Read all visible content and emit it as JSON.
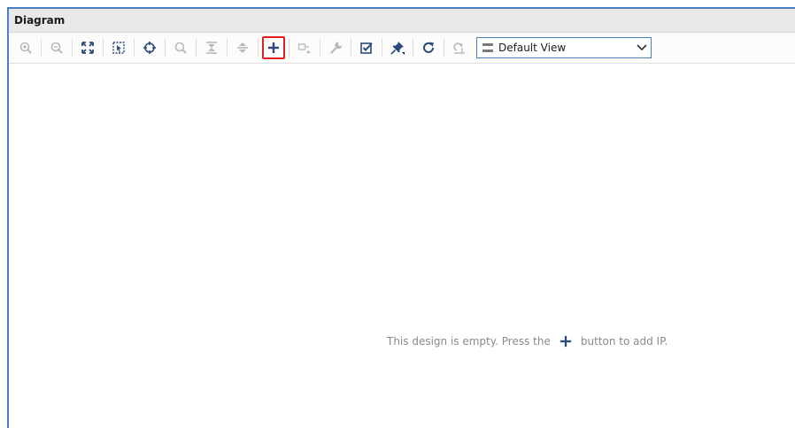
{
  "panel": {
    "title": "Diagram"
  },
  "toolbar": {
    "buttons": [
      {
        "icon": "zoom-in-icon",
        "enabled": false
      },
      {
        "icon": "zoom-out-icon",
        "enabled": false
      },
      {
        "icon": "zoom-fit-icon",
        "enabled": true
      },
      {
        "icon": "zoom-selection-icon",
        "enabled": true
      },
      {
        "icon": "crosshair-icon",
        "enabled": true
      },
      {
        "icon": "search-icon",
        "enabled": false
      },
      {
        "icon": "collapse-all-icon",
        "enabled": false
      },
      {
        "icon": "expand-all-icon",
        "enabled": false
      },
      {
        "icon": "add-ip-icon",
        "enabled": true,
        "highlighted": true
      },
      {
        "icon": "make-external-icon",
        "enabled": false
      },
      {
        "icon": "wrench-icon",
        "enabled": false
      },
      {
        "icon": "validate-design-icon",
        "enabled": true
      },
      {
        "icon": "pin-icon",
        "enabled": true
      },
      {
        "icon": "refresh-icon",
        "enabled": true
      },
      {
        "icon": "regenerate-layout-icon",
        "enabled": false
      }
    ],
    "view_select": {
      "value": "Default View"
    }
  },
  "canvas": {
    "empty_message_before": "This design is empty. Press the",
    "empty_message_after": "button to add IP."
  },
  "colors": {
    "accent": "#4a7fc1",
    "icon_active": "#2b4a7a",
    "icon_disabled": "#b8b8b8",
    "highlight": "#e02020"
  }
}
